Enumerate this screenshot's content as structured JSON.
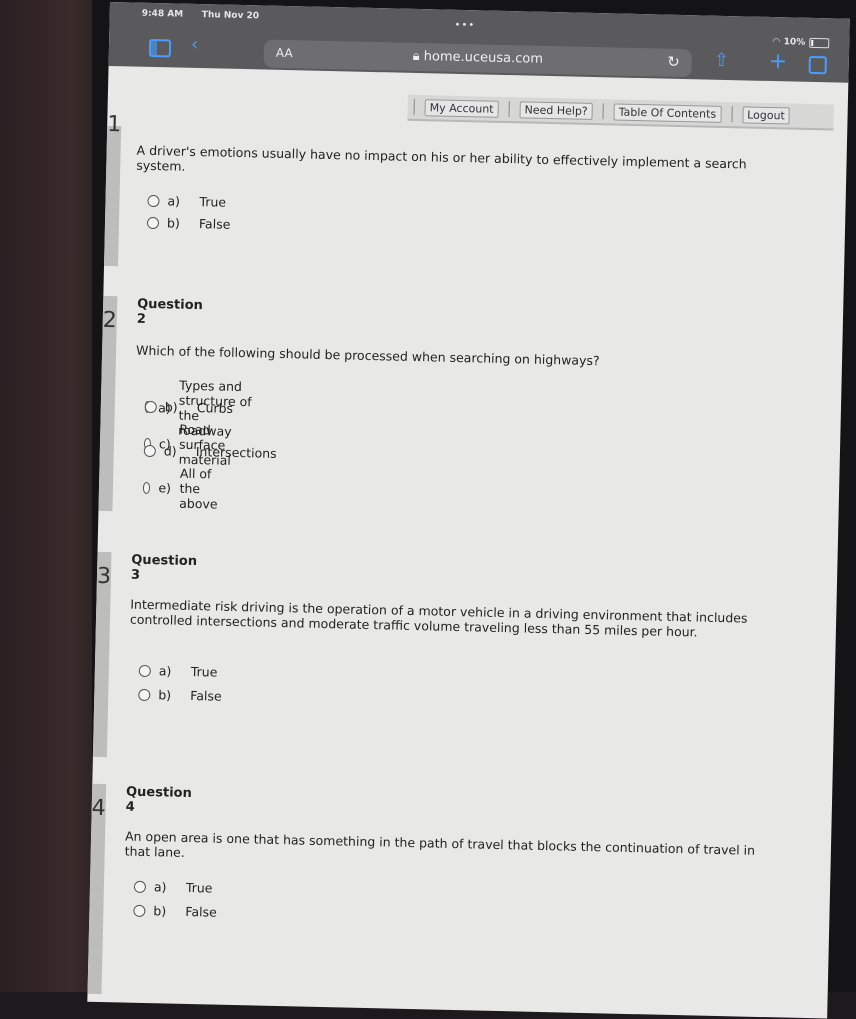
{
  "status": {
    "time": "9:48 AM",
    "date": "Thu Nov 20",
    "battery": "10%"
  },
  "browser": {
    "text_size_label": "AA",
    "url": "home.uceusa.com"
  },
  "nav": {
    "my_account": "My Account",
    "need_help": "Need Help?",
    "toc": "Table Of Contents",
    "logout": "Logout"
  },
  "questions": [
    {
      "number": "1",
      "title": "",
      "text": "A driver's emotions usually have no impact on his or her ability to effectively implement a search system.",
      "options": [
        {
          "letter": "a)",
          "label": "True"
        },
        {
          "letter": "b)",
          "label": "False"
        }
      ]
    },
    {
      "number": "2",
      "title": "Question 2",
      "text": "Which of the following should be processed when searching on highways?",
      "options": [
        {
          "letter": "a)",
          "label": "Types and structure of the roadway"
        },
        {
          "letter": "b)",
          "label": "Curbs"
        },
        {
          "letter": "c)",
          "label": "Road surface material"
        },
        {
          "letter": "d)",
          "label": "Intersections"
        },
        {
          "letter": "e)",
          "label": "All of the above"
        }
      ]
    },
    {
      "number": "3",
      "title": "Question 3",
      "text": "Intermediate risk driving is the operation of a motor vehicle in a driving environment that includes controlled intersections and moderate traffic volume traveling less than 55 miles per hour.",
      "options": [
        {
          "letter": "a)",
          "label": "True"
        },
        {
          "letter": "b)",
          "label": "False"
        }
      ]
    },
    {
      "number": "4",
      "title": "Question 4",
      "text": "An open area is one that has something in the path of travel that blocks the continuation of travel in that lane.",
      "options": [
        {
          "letter": "a)",
          "label": "True"
        },
        {
          "letter": "b)",
          "label": "False"
        }
      ]
    }
  ]
}
